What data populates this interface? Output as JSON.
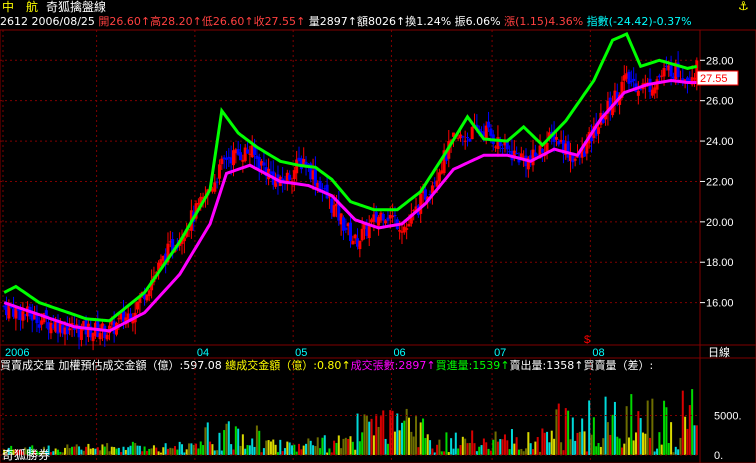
{
  "header": {
    "stock_name": "中　航",
    "chart_title": "奇狐擒盤線",
    "pin_icon": "pin-icon"
  },
  "quote": {
    "code": "2612",
    "date": "2006/08/25",
    "open_label": "開",
    "open": "26.60",
    "high_label": "高",
    "high": "28.20",
    "low_label": "低",
    "low": "26.60",
    "close_label": "收",
    "close": "27.55",
    "volume_label": "量",
    "volume": "2897",
    "amount_label": "額",
    "amount": "8026",
    "turnover_label": "換",
    "turnover": "1.24%",
    "amplitude_label": "振",
    "amplitude": "6.06%",
    "change_label": "漲",
    "change": "(1.15)",
    "change_pct": "4.36%",
    "index_label": "指數",
    "index_change": "(-24.42)",
    "index_pct": "-0.37%",
    "up_arrow": "↑"
  },
  "volume_panel": {
    "title": "買賣成交量",
    "est_label": "加權預估成交金額（億）:",
    "est_value": "597.08",
    "total_label": "總成交金額（億）:",
    "total_value": "0.80",
    "deals_label": "成交張數:",
    "deals_value": "2897",
    "buy_label": "買進量:",
    "buy_value": "1539",
    "sell_label": "賣出量:",
    "sell_value": "1358",
    "net_label": "買賣量（差）:",
    "up_arrow": "↑",
    "brand": "奇狐勝券",
    "y_ticks": [
      "5000.",
      "0."
    ]
  },
  "price_axis": {
    "ticks": [
      "28.00",
      "26.00",
      "24.00",
      "22.00",
      "20.00",
      "18.00",
      "16.00"
    ],
    "current_price": "27.55",
    "marker": "$"
  },
  "date_axis": {
    "labels": [
      "2006",
      "04",
      "05",
      "06",
      "07",
      "08"
    ],
    "period": "日線"
  },
  "colors": {
    "up": "#ff0000",
    "down": "#0000ff",
    "ma_fast": "#00ff00",
    "ma_slow": "#ff00ff",
    "grid": "#800000",
    "label_yellow": "#ffff00",
    "label_cyan": "#00ffff",
    "label_magenta": "#ff00ff",
    "label_green": "#00ff00"
  },
  "chart_data": {
    "type": "candlestick",
    "ylim": [
      14.0,
      29.5
    ],
    "ticks": [
      16,
      18,
      20,
      22,
      24,
      26,
      28
    ],
    "anchors": [
      [
        0,
        15.8
      ],
      [
        10,
        15.4
      ],
      [
        20,
        15.0
      ],
      [
        30,
        14.7
      ],
      [
        45,
        14.6
      ],
      [
        55,
        15.6
      ],
      [
        70,
        18.5
      ],
      [
        85,
        21.0
      ],
      [
        95,
        23.2
      ],
      [
        105,
        23.5
      ],
      [
        118,
        21.8
      ],
      [
        128,
        23.1
      ],
      [
        138,
        21.2
      ],
      [
        150,
        19.0
      ],
      [
        162,
        20.5
      ],
      [
        172,
        19.7
      ],
      [
        182,
        21.8
      ],
      [
        192,
        24.0
      ],
      [
        205,
        24.6
      ],
      [
        215,
        23.5
      ],
      [
        225,
        23.0
      ],
      [
        235,
        24.3
      ],
      [
        245,
        23.0
      ],
      [
        255,
        25.0
      ],
      [
        265,
        27.0
      ],
      [
        275,
        26.7
      ],
      [
        285,
        27.6
      ],
      [
        292,
        27.2
      ],
      [
        296,
        27.55
      ]
    ],
    "ma_fast_anchors": [
      [
        0,
        16.5
      ],
      [
        5,
        16.8
      ],
      [
        15,
        16.0
      ],
      [
        25,
        15.6
      ],
      [
        35,
        15.2
      ],
      [
        45,
        15.1
      ],
      [
        60,
        16.5
      ],
      [
        75,
        19.0
      ],
      [
        88,
        21.6
      ],
      [
        93,
        25.5
      ],
      [
        100,
        24.4
      ],
      [
        108,
        23.7
      ],
      [
        118,
        23.0
      ],
      [
        126,
        22.8
      ],
      [
        133,
        22.7
      ],
      [
        140,
        22.1
      ],
      [
        148,
        21.0
      ],
      [
        158,
        20.6
      ],
      [
        168,
        20.6
      ],
      [
        178,
        21.5
      ],
      [
        188,
        23.3
      ],
      [
        198,
        25.2
      ],
      [
        205,
        24.1
      ],
      [
        215,
        24.0
      ],
      [
        222,
        24.7
      ],
      [
        230,
        23.8
      ],
      [
        240,
        25.0
      ],
      [
        252,
        27.0
      ],
      [
        260,
        29.0
      ],
      [
        266,
        29.3
      ],
      [
        272,
        27.7
      ],
      [
        280,
        28.0
      ],
      [
        292,
        27.6
      ],
      [
        296,
        27.7
      ]
    ],
    "ma_slow_anchors": [
      [
        0,
        16.0
      ],
      [
        10,
        15.6
      ],
      [
        20,
        15.2
      ],
      [
        30,
        14.8
      ],
      [
        45,
        14.6
      ],
      [
        60,
        15.5
      ],
      [
        75,
        17.4
      ],
      [
        88,
        19.9
      ],
      [
        95,
        22.4
      ],
      [
        105,
        22.8
      ],
      [
        118,
        22.0
      ],
      [
        130,
        21.8
      ],
      [
        140,
        21.3
      ],
      [
        150,
        20.1
      ],
      [
        160,
        19.7
      ],
      [
        170,
        19.9
      ],
      [
        180,
        20.9
      ],
      [
        192,
        22.6
      ],
      [
        205,
        23.3
      ],
      [
        215,
        23.3
      ],
      [
        225,
        23.0
      ],
      [
        235,
        23.6
      ],
      [
        245,
        23.3
      ],
      [
        255,
        25.1
      ],
      [
        265,
        26.4
      ],
      [
        275,
        26.8
      ],
      [
        285,
        27.0
      ],
      [
        292,
        26.9
      ],
      [
        296,
        26.9
      ]
    ],
    "volume_ylim": [
      0,
      10000
    ],
    "series": [
      {
        "name": "買進量"
      },
      {
        "name": "賣出量"
      }
    ]
  }
}
